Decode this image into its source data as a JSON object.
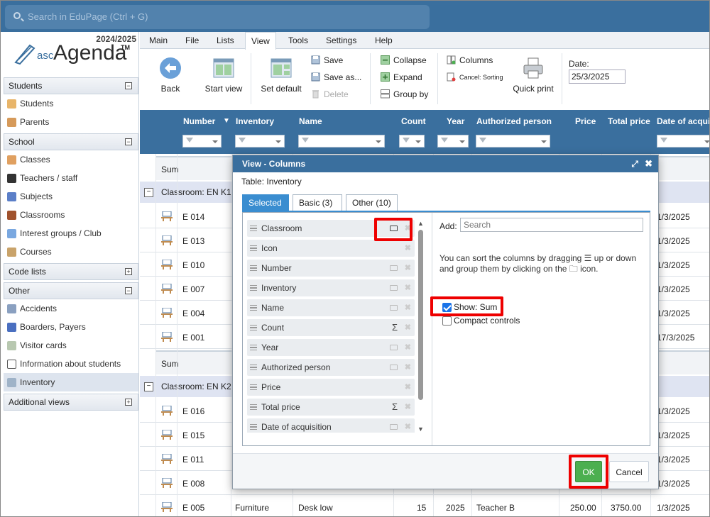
{
  "search": {
    "placeholder": "Search in EduPage (Ctrl + G)"
  },
  "logo": {
    "year": "2024/2025",
    "asc": "asc",
    "name": "Agenda",
    "tm": "TM"
  },
  "sidebar": {
    "students": {
      "title": "Students",
      "items": [
        "Students",
        "Parents"
      ]
    },
    "school": {
      "title": "School",
      "items": [
        "Classes",
        "Teachers / staff",
        "Subjects",
        "Classrooms",
        "Interest groups / Club",
        "Courses"
      ]
    },
    "codelists": {
      "title": "Code lists"
    },
    "other": {
      "title": "Other",
      "items": [
        "Accidents",
        "Boarders, Payers",
        "Visitor cards",
        "Information about students",
        "Inventory"
      ]
    },
    "additional": {
      "title": "Additional views"
    },
    "toggle_minus": "−",
    "toggle_plus": "+"
  },
  "menu": [
    "Main",
    "File",
    "Lists",
    "View",
    "Tools",
    "Settings",
    "Help"
  ],
  "toolbar": {
    "back": "Back",
    "start_view": "Start view",
    "set_default": "Set default",
    "save": "Save",
    "save_as": "Save as...",
    "delete": "Delete",
    "collapse": "Collapse",
    "expand": "Expand",
    "group_by": "Group by",
    "columns": "Columns",
    "cancel_sorting": "Cancel: Sorting",
    "quick_print": "Quick print",
    "date_label": "Date:",
    "date_value": "25/3/2025"
  },
  "grid": {
    "headers": [
      "Number",
      "Inventory",
      "Name",
      "Count",
      "Year",
      "Authorized person",
      "Price",
      "Total price",
      "Date of acqui"
    ],
    "sum_label": "Sum",
    "group1": "Classroom: EN K1",
    "group2": "Classroom: EN K2",
    "group_toggle": "−",
    "rows_g1": [
      {
        "code": "E 014",
        "date": "1/3/2025"
      },
      {
        "code": "E 013",
        "date": "1/3/2025"
      },
      {
        "code": "E 010",
        "date": "1/3/2025"
      },
      {
        "code": "E 007",
        "date": "1/3/2025"
      },
      {
        "code": "E 004",
        "date": "1/3/2025"
      },
      {
        "code": "E 001",
        "date": "17/3/2025"
      }
    ],
    "rows_g2": [
      {
        "code": "E 016",
        "date": "1/3/2025"
      },
      {
        "code": "E 015",
        "date": "1/3/2025"
      },
      {
        "code": "E 011",
        "date": "1/3/2025"
      },
      {
        "code": "E 008",
        "date": "1/3/2025"
      },
      {
        "code": "E 005",
        "inventory": "Furniture",
        "name": "Desk low",
        "count": "15",
        "year": "2025",
        "person": "Teacher B",
        "price": "250.00",
        "total": "3750.00",
        "date": "1/3/2025"
      }
    ]
  },
  "dialog": {
    "title": "View - Columns",
    "table_label": "Table: Inventory",
    "tabs": [
      "Selected",
      "Basic (3)",
      "Other (10)"
    ],
    "columns": [
      {
        "label": "Classroom",
        "mark": "folder"
      },
      {
        "label": "Icon",
        "mark": "none"
      },
      {
        "label": "Number",
        "mark": "folder"
      },
      {
        "label": "Inventory",
        "mark": "folder"
      },
      {
        "label": "Name",
        "mark": "folder"
      },
      {
        "label": "Count",
        "mark": "sum"
      },
      {
        "label": "Year",
        "mark": "folder"
      },
      {
        "label": "Authorized person",
        "mark": "folder"
      },
      {
        "label": "Price",
        "mark": "none"
      },
      {
        "label": "Total price",
        "mark": "sum"
      },
      {
        "label": "Date of acquisition",
        "mark": "folder"
      }
    ],
    "sum_symbol": "Σ",
    "delete_symbol": "✖",
    "add_label": "Add:",
    "add_placeholder": "Search",
    "hint": "You can sort the columns by dragging ☰ up or down and group them by clicking on the 🗀 icon.",
    "show_sum": "Show: Sum",
    "show_sum_checked": true,
    "compact": "Compact controls",
    "compact_checked": false,
    "ok": "OK",
    "cancel": "Cancel",
    "expand_icon": "⤢",
    "close_icon": "✖"
  },
  "colors": {
    "accent": "#3a6f9e",
    "highlight": "#e00000",
    "ok": "#4caf50",
    "tab": "#3a8dd0"
  }
}
